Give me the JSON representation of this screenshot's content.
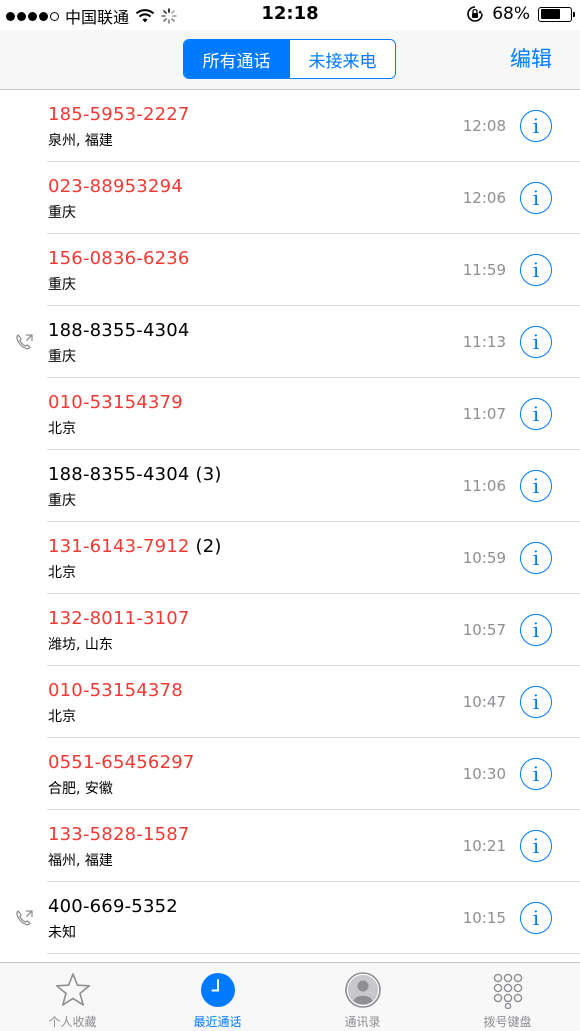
{
  "status_bar": {
    "carrier": "中国联通",
    "time": "12:18",
    "battery": "68%",
    "battery_level": 0.68
  },
  "nav": {
    "segments": [
      "所有通话",
      "未接来电"
    ],
    "active_segment": 0,
    "edit_label": "编辑"
  },
  "calls": [
    {
      "number": "185-5953-2227",
      "count": "",
      "location": "泉州, 福建",
      "time": "12:08",
      "missed": true,
      "outgoing": false
    },
    {
      "number": "023-88953294",
      "count": "",
      "location": "重庆",
      "time": "12:06",
      "missed": true,
      "outgoing": false
    },
    {
      "number": "156-0836-6236",
      "count": "",
      "location": "重庆",
      "time": "11:59",
      "missed": true,
      "outgoing": false
    },
    {
      "number": "188-8355-4304",
      "count": "",
      "location": "重庆",
      "time": "11:13",
      "missed": false,
      "outgoing": true
    },
    {
      "number": "010-53154379",
      "count": "",
      "location": "北京",
      "time": "11:07",
      "missed": true,
      "outgoing": false
    },
    {
      "number": "188-8355-4304",
      "count": "(3)",
      "location": "重庆",
      "time": "11:06",
      "missed": false,
      "outgoing": false
    },
    {
      "number": "131-6143-7912",
      "count": "(2)",
      "location": "北京",
      "time": "10:59",
      "missed": true,
      "outgoing": false
    },
    {
      "number": "132-8011-3107",
      "count": "",
      "location": "潍坊, 山东",
      "time": "10:57",
      "missed": true,
      "outgoing": false
    },
    {
      "number": "010-53154378",
      "count": "",
      "location": "北京",
      "time": "10:47",
      "missed": true,
      "outgoing": false
    },
    {
      "number": "0551-65456297",
      "count": "",
      "location": "合肥, 安徽",
      "time": "10:30",
      "missed": true,
      "outgoing": false
    },
    {
      "number": "133-5828-1587",
      "count": "",
      "location": "福州, 福建",
      "time": "10:21",
      "missed": true,
      "outgoing": false
    },
    {
      "number": "400-669-5352",
      "count": "",
      "location": "未知",
      "time": "10:15",
      "missed": false,
      "outgoing": true
    }
  ],
  "tabs": [
    {
      "label": "个人收藏",
      "icon": "star-icon"
    },
    {
      "label": "最近通话",
      "icon": "clock-icon"
    },
    {
      "label": "通讯录",
      "icon": "contacts-icon"
    },
    {
      "label": "拨号键盘",
      "icon": "keypad-icon"
    }
  ],
  "active_tab": 1,
  "colors": {
    "accent": "#007aff",
    "missed": "#f03a33",
    "secondary": "#8e8e93"
  }
}
